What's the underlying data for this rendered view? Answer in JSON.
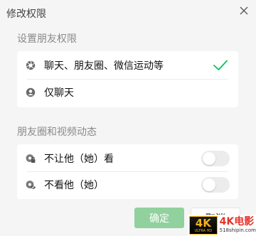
{
  "dialog": {
    "title": "修改权限",
    "close_icon": "close-icon"
  },
  "friend_permissions": {
    "section_label": "设置朋友权限",
    "options": [
      {
        "label": "聊天、朋友圈、微信运动等",
        "icon": "aperture-icon",
        "selected": true
      },
      {
        "label": "仅聊天",
        "icon": "person-icon",
        "selected": false
      }
    ]
  },
  "moments": {
    "section_label": "朋友圈和视频动态",
    "items": [
      {
        "label": "不让他（她）看",
        "icon": "lock-icon",
        "enabled": false
      },
      {
        "label": "不看他（她）",
        "icon": "hidden-eye-icon",
        "enabled": false
      }
    ]
  },
  "footer": {
    "confirm_label": "确定",
    "cancel_label": "取消"
  },
  "watermark": {
    "badge_big": "4K",
    "badge_small": "ULTRA HD",
    "title": "4K电影",
    "site": "518shipin.com"
  },
  "colors": {
    "background": "#f5f5f5",
    "card": "#ffffff",
    "accent_green": "#07c160",
    "confirm_disabled": "#91d19e",
    "section_text": "#8a8a8a"
  }
}
